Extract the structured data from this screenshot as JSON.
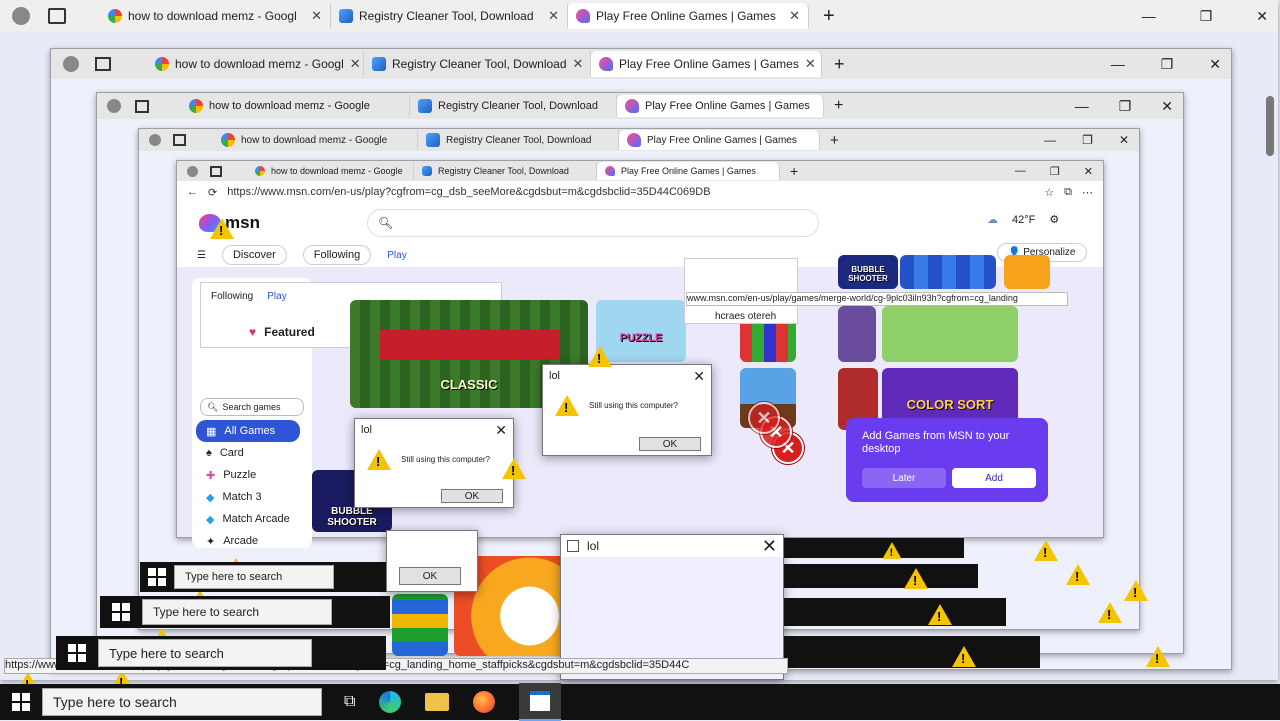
{
  "tabs": [
    {
      "label": "how to download memz - Googl",
      "icon": "google-icon"
    },
    {
      "label": "Registry Cleaner Tool, Download",
      "icon": "registry-icon"
    },
    {
      "label": "Play Free Online Games | Games",
      "icon": "msn-icon"
    }
  ],
  "tabs_small": [
    {
      "label": "how to download memz - Google"
    },
    {
      "label": "Registry Cleaner Tool, Download"
    },
    {
      "label": "Play Free Online Games | Games"
    }
  ],
  "address": "https://www.msn.com/en-us/play?cgfrom=cg_dsb_seeMore&cgdsbut=m&cgdsbclid=35D44C069DB",
  "msn": {
    "logo": "msn",
    "nav": [
      "Discover",
      "Following",
      "Play"
    ],
    "weather": "42°F",
    "personalize": "Personalize",
    "featured": "Featured",
    "search_placeholder": "Search games",
    "sidebar": [
      "All Games",
      "Card",
      "Puzzle",
      "Match 3",
      "Match Arcade",
      "Arcade"
    ]
  },
  "tiles": {
    "classic": "CLASSIC",
    "puzzle": "PUZZLE",
    "bubble": "BUBBLE SHOOTER",
    "color_sort": "COLOR SORT"
  },
  "promo": {
    "text": "Add Games from MSN to your desktop",
    "later": "Later",
    "add": "Add"
  },
  "dialog": {
    "title": "lol",
    "message": "Still using this computer?",
    "ok": "OK"
  },
  "status_url": "https://www.msn.com/en-us/play/games/merge-world/cg-9plc03iln93h?cgfrom=cg_landing_home_staffpicks&cgdsbut=m&cgdsbclid=35D44C",
  "status_url_small": "www.msn.com/en-us/play/games/merge-world/cg-9plc03iln93h?cgfrom=cg_landing",
  "taskbar": {
    "search_placeholder": "Type here to search"
  },
  "mirrored_text": "hcraes otereh",
  "colors": {
    "accent": "#2f55d4",
    "promo": "#6a3cf0",
    "taskbar": "#111111",
    "warning": "#f5c400",
    "error": "#d81e1e"
  }
}
